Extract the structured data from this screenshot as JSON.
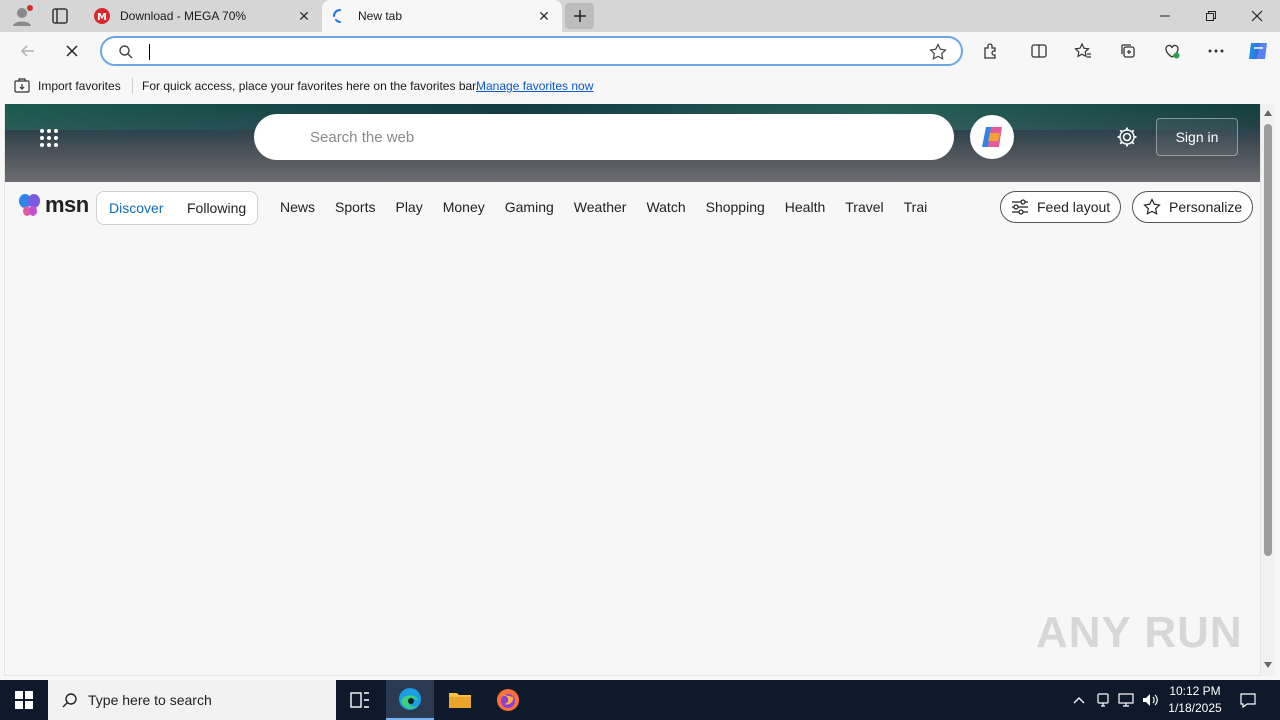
{
  "tabs": [
    {
      "title": "Download - MEGA 70%",
      "active": false,
      "favicon": "mega-icon"
    },
    {
      "title": "New tab",
      "active": true,
      "favicon": "loading-spinner-icon"
    }
  ],
  "omnibox": {
    "value": "",
    "placeholder": ""
  },
  "favorites_bar": {
    "import_label": "Import favorites",
    "hint": "For quick access, place your favorites here on the favorites bar.",
    "manage_link": "Manage favorites now"
  },
  "msn": {
    "search_placeholder": "Search the web",
    "sign_in": "Sign in",
    "logo_text": "msn",
    "feed_tabs": {
      "discover": "Discover",
      "following": "Following"
    },
    "nav": [
      "News",
      "Sports",
      "Play",
      "Money",
      "Gaming",
      "Weather",
      "Watch",
      "Shopping",
      "Health",
      "Travel",
      "Trai"
    ],
    "feed_layout": "Feed layout",
    "personalize": "Personalize"
  },
  "watermark": "ANY RUN",
  "taskbar": {
    "search_placeholder": "Type here to search",
    "time": "10:12 PM",
    "date": "1/18/2025"
  },
  "colors": {
    "accent": "#0f6cbd",
    "omnibox_border": "#6aa7e6",
    "taskbar": "#0e1a2b"
  }
}
